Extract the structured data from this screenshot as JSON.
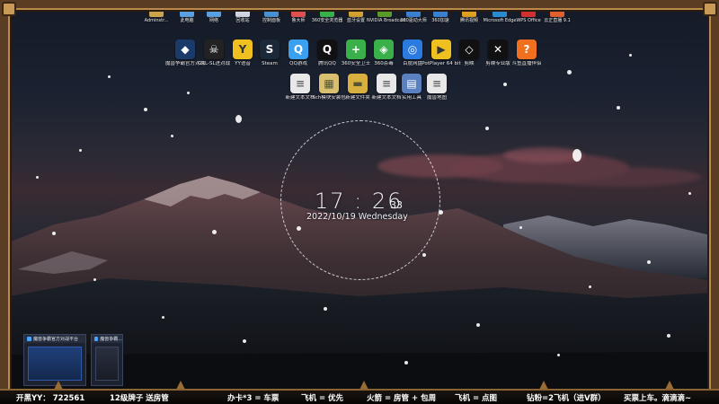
{
  "top_icons": [
    {
      "label": "Adminstr...",
      "color": "#c9a24a"
    },
    {
      "label": "此电脑",
      "color": "#5aa0e0"
    },
    {
      "label": "网络",
      "color": "#5aa0e0"
    },
    {
      "label": "回收站",
      "color": "#cfd6e0"
    },
    {
      "label": "控制面板",
      "color": "#4a8fd0"
    },
    {
      "label": "鲁大师",
      "color": "#e05050"
    },
    {
      "label": "360安全浏览器",
      "color": "#3ab04a"
    },
    {
      "label": "蓝牙设置",
      "color": "#d0a030"
    },
    {
      "label": "NVIDIA Broadcast",
      "color": "#5a9a2a"
    },
    {
      "label": "360驱动大师",
      "color": "#3a80d0"
    },
    {
      "label": "360加速",
      "color": "#3a80d0"
    },
    {
      "label": "腾讯视频",
      "color": "#e0a020"
    },
    {
      "label": "Microsoft Edge",
      "color": "#2a8ad0"
    },
    {
      "label": "WPS Office",
      "color": "#d03030"
    },
    {
      "label": "云正直播 9.1",
      "color": "#e06030"
    }
  ],
  "row2_icons": [
    {
      "label": "魔兽争霸官方对战平台",
      "color": "#1a3a6a",
      "glyph": "◆"
    },
    {
      "label": "GRL-SL进对战",
      "color": "#222",
      "glyph": "☠"
    },
    {
      "label": "YY语音",
      "color": "#f0c020",
      "glyph": "Y"
    },
    {
      "label": "Steam",
      "color": "#1b2838",
      "glyph": "S"
    },
    {
      "label": "QQ游戏",
      "color": "#3aa0f0",
      "glyph": "Q"
    },
    {
      "label": "腾讯QQ",
      "color": "#111",
      "glyph": "Q"
    },
    {
      "label": "360安全卫士",
      "color": "#3ab04a",
      "glyph": "+"
    },
    {
      "label": "360杀毒",
      "color": "#3ab04a",
      "glyph": "◈"
    },
    {
      "label": "百度网盘",
      "color": "#2a7ae0",
      "glyph": "◎"
    },
    {
      "label": "PotPlayer 64 bit",
      "color": "#f0c020",
      "glyph": "▶"
    },
    {
      "label": "剪映",
      "color": "#111",
      "glyph": "◇"
    },
    {
      "label": "剪映专业版",
      "color": "#111",
      "glyph": "✕"
    },
    {
      "label": "斗鱼直播伴侣",
      "color": "#f07020",
      "glyph": "?"
    }
  ],
  "row3_icons": [
    {
      "label": "新建文本文档",
      "color": "#e8e8e8",
      "glyph": "≡"
    },
    {
      "label": "Sch模块安装包",
      "color": "#d8c070",
      "glyph": "▦"
    },
    {
      "label": "新建文件夹",
      "color": "#d8b040",
      "glyph": "▬"
    },
    {
      "label": "新建文本文档",
      "color": "#e8e8e8",
      "glyph": "≡"
    },
    {
      "label": "实用工具",
      "color": "#5a80c0",
      "glyph": "▤"
    },
    {
      "label": "魔兽地图",
      "color": "#e8e8e8",
      "glyph": "≡"
    }
  ],
  "clock": {
    "hours": "17",
    "minutes": "26",
    "seconds": "33",
    "date": "2022/10/19",
    "weekday": "Wednesday"
  },
  "thumbnails": [
    {
      "title": "魔兽争霸官方对战平台"
    },
    {
      "title": "魔兽争霸..."
    }
  ],
  "marquee": {
    "seg1": "开黑YY： 722561",
    "seg2": "12级牌子 送房管",
    "seg3": "办卡*3 = 车票",
    "seg4": "飞机 = 优先",
    "seg5": "火箭 = 房管 + 包周",
    "seg6": "飞机 = 点图",
    "seg7": "钻粉=2飞机（进V群）",
    "seg8": "买票上车。滴滴滴~"
  },
  "colors": {
    "frame": "#5a3d22",
    "frame_highlight": "#b98a4b",
    "marquee_bg": "#070605"
  }
}
